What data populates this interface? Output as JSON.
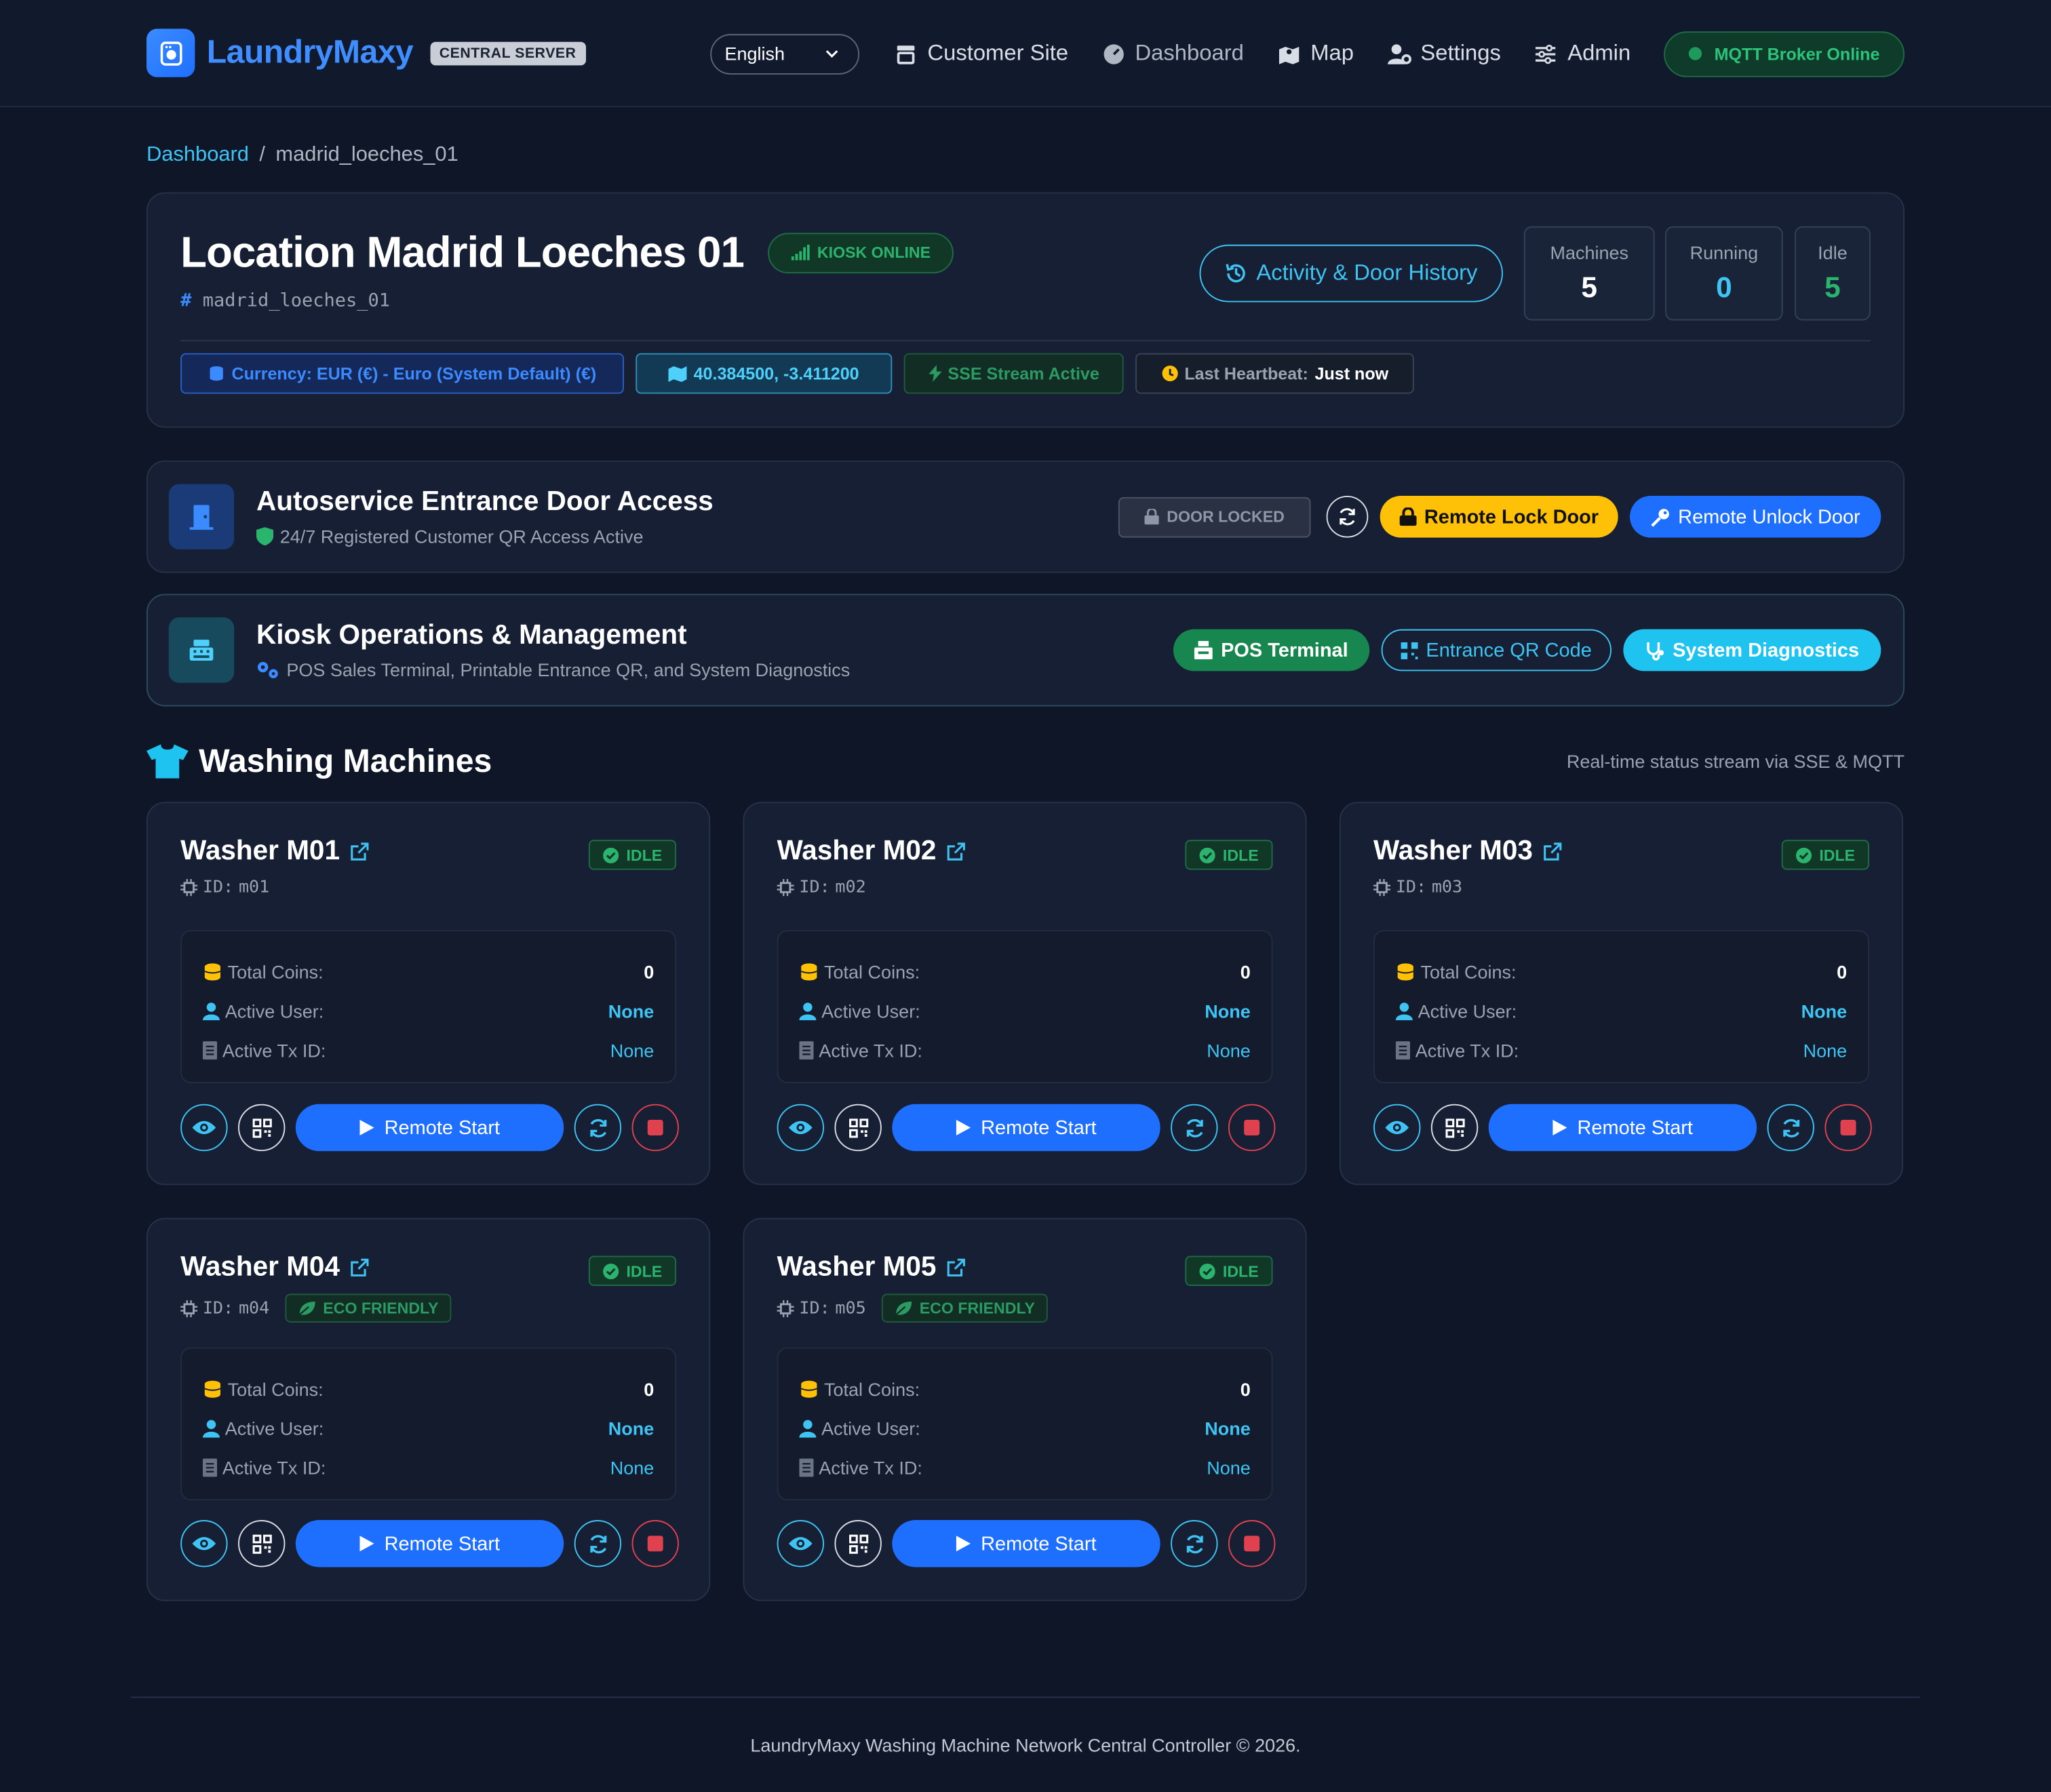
{
  "brand": {
    "name": "LaundryMaxy",
    "tag": "CENTRAL SERVER"
  },
  "nav": {
    "language": "English",
    "links": [
      "Customer Site",
      "Dashboard",
      "Map",
      "Settings",
      "Admin"
    ],
    "mqtt_status": "MQTT Broker Online"
  },
  "breadcrumb": {
    "root": "Dashboard",
    "separator": "/",
    "current": "madrid_loeches_01"
  },
  "location": {
    "title": "Location Madrid Loeches 01",
    "kiosk_status": "KIOSK ONLINE",
    "id_hash": "#",
    "id": "madrid_loeches_01",
    "activity_button": "Activity & Door History",
    "stats": [
      {
        "label": "Machines",
        "value": "5",
        "color": "#ffffff"
      },
      {
        "label": "Running",
        "value": "0",
        "color": "#3ec3f2"
      },
      {
        "label": "Idle",
        "value": "5",
        "color": "#2bb46d"
      }
    ],
    "currency": "Currency: EUR (€) - Euro (System Default) (€)",
    "coordinates": "40.384500, -3.411200",
    "sse": "SSE Stream Active",
    "heartbeat_label": "Last Heartbeat:",
    "heartbeat_value": "Just now"
  },
  "door": {
    "title": "Autoservice Entrance Door Access",
    "subtitle": "24/7 Registered Customer QR Access Active",
    "status": "DOOR LOCKED",
    "lock_label": "Remote Lock Door",
    "unlock_label": "Remote Unlock Door"
  },
  "kiosk": {
    "title": "Kiosk Operations & Management",
    "subtitle": "POS Sales Terminal, Printable Entrance QR, and System Diagnostics",
    "pos_label": "POS Terminal",
    "qr_label": "Entrance QR Code",
    "diag_label": "System Diagnostics"
  },
  "section": {
    "title": "Washing Machines",
    "note": "Real-time status stream via SSE & MQTT"
  },
  "machine_labels": {
    "status": "IDLE",
    "eco": "ECO FRIENDLY",
    "id_prefix": "ID:",
    "coins": "Total Coins:",
    "user": "Active User:",
    "tx": "Active Tx ID:",
    "start": "Remote Start"
  },
  "machines": [
    {
      "name": "Washer M01",
      "id": "m01",
      "eco": false,
      "coins": "0",
      "user": "None",
      "tx": "None"
    },
    {
      "name": "Washer M02",
      "id": "m02",
      "eco": false,
      "coins": "0",
      "user": "None",
      "tx": "None"
    },
    {
      "name": "Washer M03",
      "id": "m03",
      "eco": false,
      "coins": "0",
      "user": "None",
      "tx": "None"
    },
    {
      "name": "Washer M04",
      "id": "m04",
      "eco": true,
      "coins": "0",
      "user": "None",
      "tx": "None"
    },
    {
      "name": "Washer M05",
      "id": "m05",
      "eco": true,
      "coins": "0",
      "user": "None",
      "tx": "None"
    }
  ],
  "footer": "LaundryMaxy Washing Machine Network Central Controller © 2026."
}
